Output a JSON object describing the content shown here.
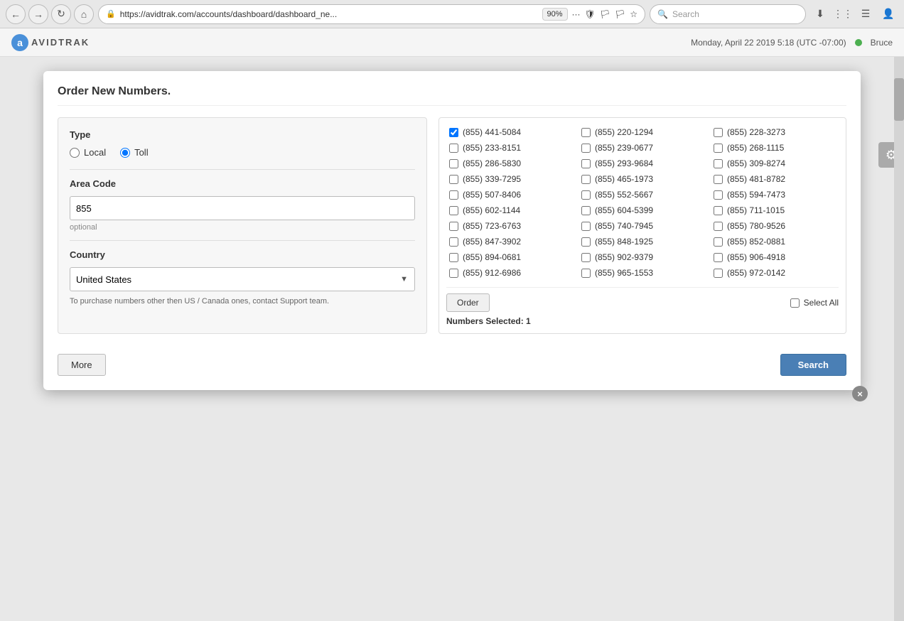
{
  "browser": {
    "address": "https://avidtrak.com/accounts/dashboard/dashboard_ne...",
    "zoom": "90%",
    "search_placeholder": "Search"
  },
  "app": {
    "logo_letter": "a",
    "logo_name": "AVIDTRAK",
    "datetime": "Monday, April 22 2019 5:18 (UTC -07:00)",
    "user": "Bruce"
  },
  "modal": {
    "title": "Order New Numbers.",
    "close_label": "×",
    "type_label": "Type",
    "radio_local": "Local",
    "radio_toll": "Toll",
    "area_code_label": "Area Code",
    "area_code_value": "855",
    "optional_text": "optional",
    "country_label": "Country",
    "country_value": "United States",
    "support_note": "To purchase numbers other then US / Canada ones, contact Support team.",
    "more_button": "More",
    "search_button": "Search",
    "order_button": "Order",
    "select_all_label": "Select All",
    "numbers_selected_label": "Numbers Selected:",
    "numbers_selected_count": "1"
  },
  "phone_numbers": [
    {
      "id": "n1",
      "number": "(855) 441-5084",
      "checked": true
    },
    {
      "id": "n2",
      "number": "(855) 220-1294",
      "checked": false
    },
    {
      "id": "n3",
      "number": "(855) 228-3273",
      "checked": false
    },
    {
      "id": "n4",
      "number": "(855) 233-8151",
      "checked": false
    },
    {
      "id": "n5",
      "number": "(855) 239-0677",
      "checked": false
    },
    {
      "id": "n6",
      "number": "(855) 268-1115",
      "checked": false
    },
    {
      "id": "n7",
      "number": "(855) 286-5830",
      "checked": false
    },
    {
      "id": "n8",
      "number": "(855) 293-9684",
      "checked": false
    },
    {
      "id": "n9",
      "number": "(855) 309-8274",
      "checked": false
    },
    {
      "id": "n10",
      "number": "(855) 339-7295",
      "checked": false
    },
    {
      "id": "n11",
      "number": "(855) 465-1973",
      "checked": false
    },
    {
      "id": "n12",
      "number": "(855) 481-8782",
      "checked": false
    },
    {
      "id": "n13",
      "number": "(855) 507-8406",
      "checked": false
    },
    {
      "id": "n14",
      "number": "(855) 552-5667",
      "checked": false
    },
    {
      "id": "n15",
      "number": "(855) 594-7473",
      "checked": false
    },
    {
      "id": "n16",
      "number": "(855) 602-1144",
      "checked": false
    },
    {
      "id": "n17",
      "number": "(855) 604-5399",
      "checked": false
    },
    {
      "id": "n18",
      "number": "(855) 711-1015",
      "checked": false
    },
    {
      "id": "n19",
      "number": "(855) 723-6763",
      "checked": false
    },
    {
      "id": "n20",
      "number": "(855) 740-7945",
      "checked": false
    },
    {
      "id": "n21",
      "number": "(855) 780-9526",
      "checked": false
    },
    {
      "id": "n22",
      "number": "(855) 847-3902",
      "checked": false
    },
    {
      "id": "n23",
      "number": "(855) 848-1925",
      "checked": false
    },
    {
      "id": "n24",
      "number": "(855) 852-0881",
      "checked": false
    },
    {
      "id": "n25",
      "number": "(855) 894-0681",
      "checked": false
    },
    {
      "id": "n26",
      "number": "(855) 902-9379",
      "checked": false
    },
    {
      "id": "n27",
      "number": "(855) 906-4918",
      "checked": false
    },
    {
      "id": "n28",
      "number": "(855) 912-6986",
      "checked": false
    },
    {
      "id": "n29",
      "number": "(855) 965-1553",
      "checked": false
    },
    {
      "id": "n30",
      "number": "(855) 972-0142",
      "checked": false
    }
  ]
}
